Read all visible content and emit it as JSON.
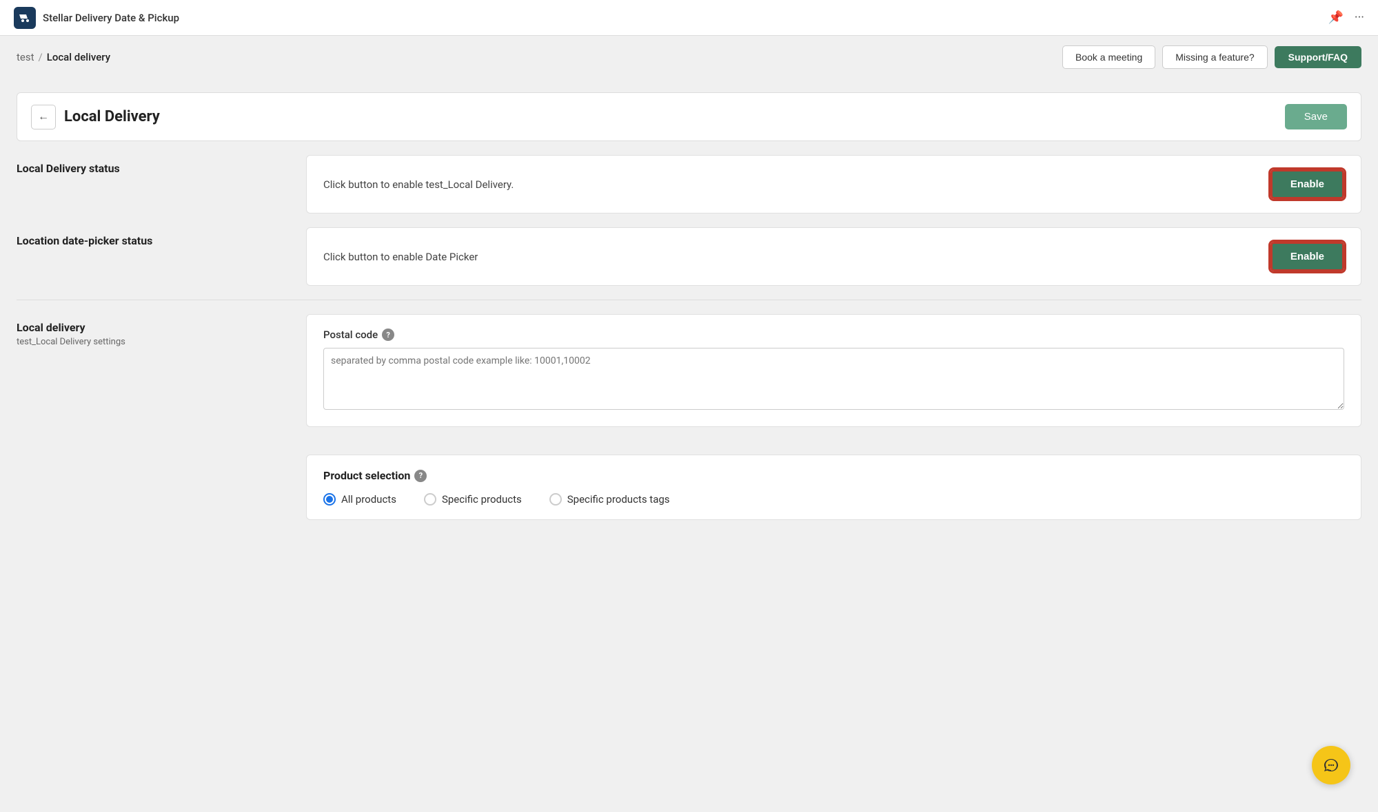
{
  "topBar": {
    "appTitle": "Stellar Delivery Date & Pickup",
    "appIconText": "🚚"
  },
  "breadcrumb": {
    "link": "test",
    "separator": "/",
    "current": "Local delivery",
    "bookMeeting": "Book a meeting",
    "missingFeature": "Missing a feature?",
    "supportFaq": "Support/FAQ"
  },
  "pageHeader": {
    "title": "Local Delivery",
    "saveLabel": "Save"
  },
  "localDeliveryStatus": {
    "label": "Local Delivery status",
    "description": "Click button to enable test_Local Delivery.",
    "buttonLabel": "Enable"
  },
  "locationDatePickerStatus": {
    "label": "Location date-picker status",
    "description": "Click button to enable Date Picker",
    "buttonLabel": "Enable"
  },
  "localDelivery": {
    "label": "Local delivery",
    "subLabel": "test_Local Delivery settings",
    "postalCodeLabel": "Postal code",
    "postalCodePlaceholder": "separated by comma postal code example like: 10001,10002"
  },
  "productSelection": {
    "label": "Product selection",
    "radioOptions": [
      {
        "id": "all",
        "label": "All products",
        "selected": true
      },
      {
        "id": "specific",
        "label": "Specific products",
        "selected": false
      },
      {
        "id": "tags",
        "label": "Specific products tags",
        "selected": false
      }
    ]
  }
}
